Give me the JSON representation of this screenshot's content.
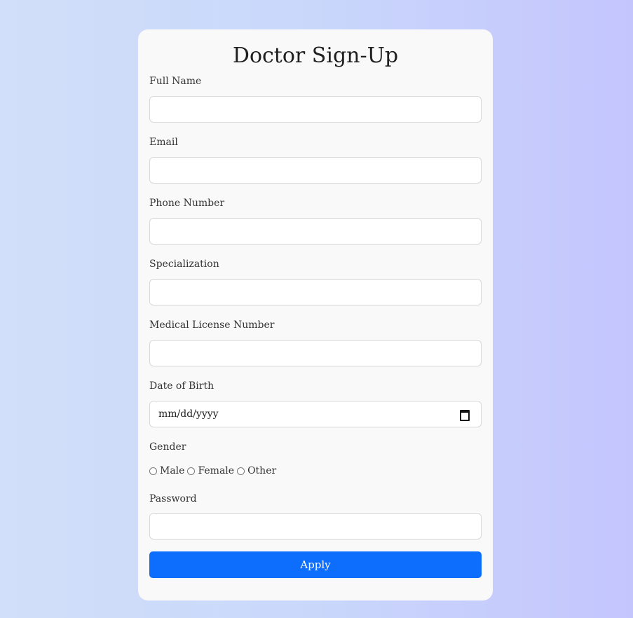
{
  "form": {
    "title": "Doctor Sign-Up",
    "fields": {
      "full_name": {
        "label": "Full Name",
        "value": ""
      },
      "email": {
        "label": "Email",
        "value": ""
      },
      "phone": {
        "label": "Phone Number",
        "value": ""
      },
      "specialization": {
        "label": "Specialization",
        "value": ""
      },
      "license": {
        "label": "Medical License Number",
        "value": ""
      },
      "dob": {
        "label": "Date of Birth",
        "placeholder": "mm/dd/yyyy"
      },
      "gender": {
        "label": "Gender",
        "options": [
          "Male",
          "Female",
          "Other"
        ],
        "selected": null
      },
      "password": {
        "label": "Password",
        "value": ""
      }
    },
    "submit_label": "Apply"
  },
  "colors": {
    "accent": "#0d6efd",
    "card": "#f9f9f9",
    "background_start": "#d1dffa",
    "background_end": "#c4c5fd"
  }
}
